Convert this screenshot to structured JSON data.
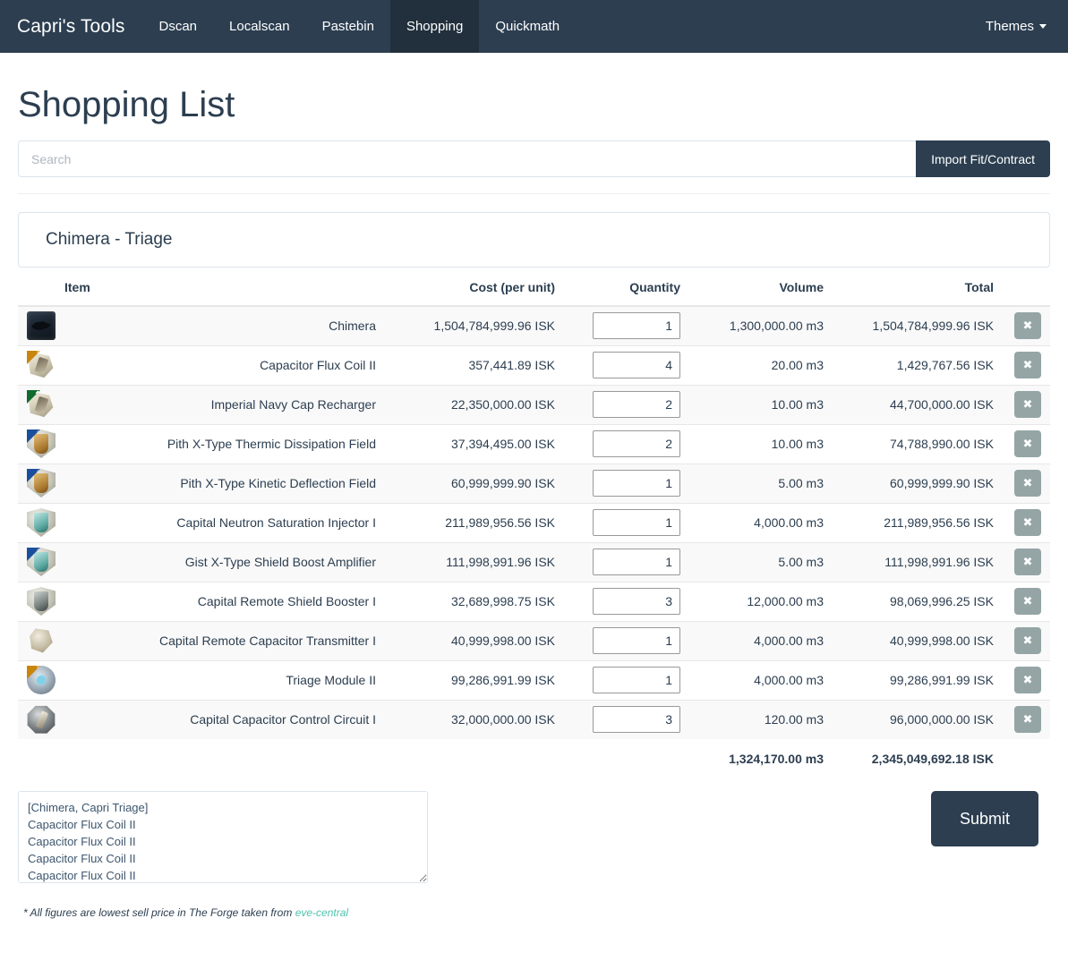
{
  "navbar": {
    "brand": "Capri's Tools",
    "items": [
      {
        "label": "Dscan",
        "active": false
      },
      {
        "label": "Localscan",
        "active": false
      },
      {
        "label": "Pastebin",
        "active": false
      },
      {
        "label": "Shopping",
        "active": true
      },
      {
        "label": "Quickmath",
        "active": false
      }
    ],
    "themes_label": "Themes"
  },
  "page": {
    "title": "Shopping List"
  },
  "search": {
    "placeholder": "Search",
    "value": "",
    "import_label": "Import Fit/Contract"
  },
  "fit": {
    "name": "Chimera - Triage"
  },
  "table": {
    "headers": {
      "item": "Item",
      "cost": "Cost (per unit)",
      "quantity": "Quantity",
      "volume": "Volume",
      "total": "Total"
    },
    "delete_label": "✖",
    "rows": [
      {
        "name": "Chimera",
        "cost": "1,504,784,999.96 ISK",
        "qty": "1",
        "volume": "1,300,000.00 m3",
        "total": "1,504,784,999.96 ISK",
        "icon": "ship-chimera-icon",
        "icon_kind": "ship",
        "badge": ""
      },
      {
        "name": "Capacitor Flux Coil II",
        "cost": "357,441.89 ISK",
        "qty": "4",
        "volume": "20.00 m3",
        "total": "1,429,767.56 ISK",
        "icon": "capacitor-flux-coil-icon",
        "icon_kind": "coil",
        "badge": "t2"
      },
      {
        "name": "Imperial Navy Cap Recharger",
        "cost": "22,350,000.00 ISK",
        "qty": "2",
        "volume": "10.00 m3",
        "total": "44,700,000.00 ISK",
        "icon": "cap-recharger-icon",
        "icon_kind": "coil",
        "badge": "faction"
      },
      {
        "name": "Pith X-Type Thermic Dissipation Field",
        "cost": "37,394,495.00 ISK",
        "qty": "2",
        "volume": "10.00 m3",
        "total": "74,788,990.00 ISK",
        "icon": "thermic-dissipation-field-icon",
        "icon_kind": "shield-gold",
        "badge": "deadspace"
      },
      {
        "name": "Pith X-Type Kinetic Deflection Field",
        "cost": "60,999,999.90 ISK",
        "qty": "1",
        "volume": "5.00 m3",
        "total": "60,999,999.90 ISK",
        "icon": "kinetic-deflection-field-icon",
        "icon_kind": "shield-gold",
        "badge": "deadspace"
      },
      {
        "name": "Capital Neutron Saturation Injector I",
        "cost": "211,989,956.56 ISK",
        "qty": "1",
        "volume": "4,000.00 m3",
        "total": "211,989,956.56 ISK",
        "icon": "neutron-saturation-injector-icon",
        "icon_kind": "shield-teal",
        "badge": ""
      },
      {
        "name": "Gist X-Type Shield Boost Amplifier",
        "cost": "111,998,991.96 ISK",
        "qty": "1",
        "volume": "5.00 m3",
        "total": "111,998,991.96 ISK",
        "icon": "shield-boost-amplifier-icon",
        "icon_kind": "shield-teal",
        "badge": "deadspace"
      },
      {
        "name": "Capital Remote Shield Booster I",
        "cost": "32,689,998.75 ISK",
        "qty": "3",
        "volume": "12,000.00 m3",
        "total": "98,069,996.25 ISK",
        "icon": "remote-shield-booster-icon",
        "icon_kind": "shield-dark",
        "badge": ""
      },
      {
        "name": "Capital Remote Capacitor Transmitter I",
        "cost": "40,999,998.00 ISK",
        "qty": "1",
        "volume": "4,000.00 m3",
        "total": "40,999,998.00 ISK",
        "icon": "remote-capacitor-transmitter-icon",
        "icon_kind": "remote",
        "badge": ""
      },
      {
        "name": "Triage Module II",
        "cost": "99,286,991.99 ISK",
        "qty": "1",
        "volume": "4,000.00 m3",
        "total": "99,286,991.99 ISK",
        "icon": "triage-module-icon",
        "icon_kind": "module",
        "badge": "t2"
      },
      {
        "name": "Capital Capacitor Control Circuit I",
        "cost": "32,000,000.00 ISK",
        "qty": "3",
        "volume": "120.00 m3",
        "total": "96,000,000.00 ISK",
        "icon": "capacitor-control-circuit-icon",
        "icon_kind": "circuit",
        "badge": ""
      }
    ],
    "totals": {
      "volume": "1,324,170.00 m3",
      "total": "2,345,049,692.18 ISK"
    }
  },
  "bottom": {
    "fit_text": "[Chimera, Capri Triage]\nCapacitor Flux Coil II\nCapacitor Flux Coil II\nCapacitor Flux Coil II\nCapacitor Flux Coil II",
    "submit_label": "Submit"
  },
  "footnote": {
    "text": "* All figures are lowest sell price in The Forge taken from ",
    "link": "eve-central"
  },
  "colors": {
    "navbar_bg": "#2c3e50",
    "navbar_active_bg": "#22303d",
    "accent_link": "#4fc3ad",
    "delete_btn": "#95a5a6",
    "border_light": "#dce4ec",
    "row_stripe": "#f9f9f9"
  }
}
